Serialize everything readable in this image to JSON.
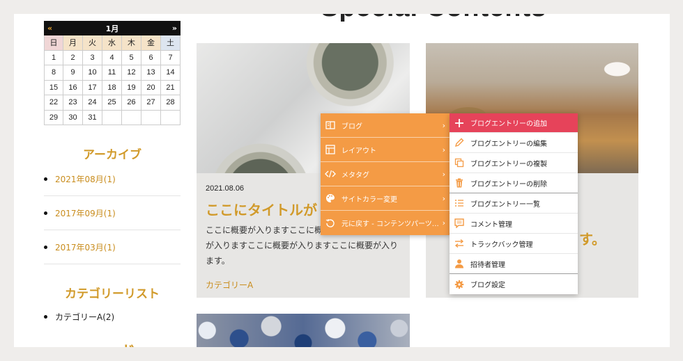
{
  "header": {
    "special_heading": "Special Contents"
  },
  "calendar": {
    "prev": "«",
    "month": "1月",
    "next": "»",
    "dow": [
      "日",
      "月",
      "火",
      "水",
      "木",
      "金",
      "土"
    ],
    "days": [
      "1",
      "2",
      "3",
      "4",
      "5",
      "6",
      "7",
      "8",
      "9",
      "10",
      "11",
      "12",
      "13",
      "14",
      "15",
      "16",
      "17",
      "18",
      "19",
      "20",
      "21",
      "22",
      "23",
      "24",
      "25",
      "26",
      "27",
      "28",
      "29",
      "30",
      "31",
      "",
      "",
      "",
      ""
    ]
  },
  "archive": {
    "title": "アーカイブ",
    "items": [
      "2021年08月(1)",
      "2017年09月(1)",
      "2017年03月(1)"
    ]
  },
  "categories": {
    "title": "カテゴリーリスト",
    "items": [
      "カテゴリーA(2)"
    ]
  },
  "card1": {
    "date": "2021.08.06",
    "title": "ここにタイトルが",
    "body": "ここに概要が入りますここに概要が入ります。概要が入りますここに概要が入りますここに概要が入ります。",
    "category": "カテゴリーA"
  },
  "card2": {
    "title_tail": "ります。"
  },
  "menu1": [
    {
      "label": "ブログ",
      "icon": "blog-icon"
    },
    {
      "label": "レイアウト",
      "icon": "layout-icon"
    },
    {
      "label": "メタタグ",
      "icon": "code-icon"
    },
    {
      "label": "サイトカラー変更",
      "icon": "palette-icon"
    },
    {
      "label": "元に戻す - コンテンツパーツ…",
      "icon": "undo-icon"
    }
  ],
  "menu2": [
    {
      "label": "ブログエントリーの追加",
      "icon": "plus-icon"
    },
    {
      "label": "ブログエントリーの編集",
      "icon": "pencil-icon"
    },
    {
      "label": "ブログエントリーの複製",
      "icon": "copy-icon"
    },
    {
      "label": "ブログエントリーの削除",
      "icon": "trash-icon"
    },
    {
      "label": "ブログエントリー一覧",
      "icon": "list-icon"
    },
    {
      "label": "コメント管理",
      "icon": "comment-icon"
    },
    {
      "label": "トラックバック管理",
      "icon": "swap-icon"
    },
    {
      "label": "招待者管理",
      "icon": "user-icon"
    },
    {
      "label": "ブログ設定",
      "icon": "gear-icon"
    }
  ],
  "colors": {
    "accent": "#d19a2a",
    "menu_orange": "#f49b45",
    "menu_active": "#e6435a",
    "menu_icon": "#f49b45"
  }
}
